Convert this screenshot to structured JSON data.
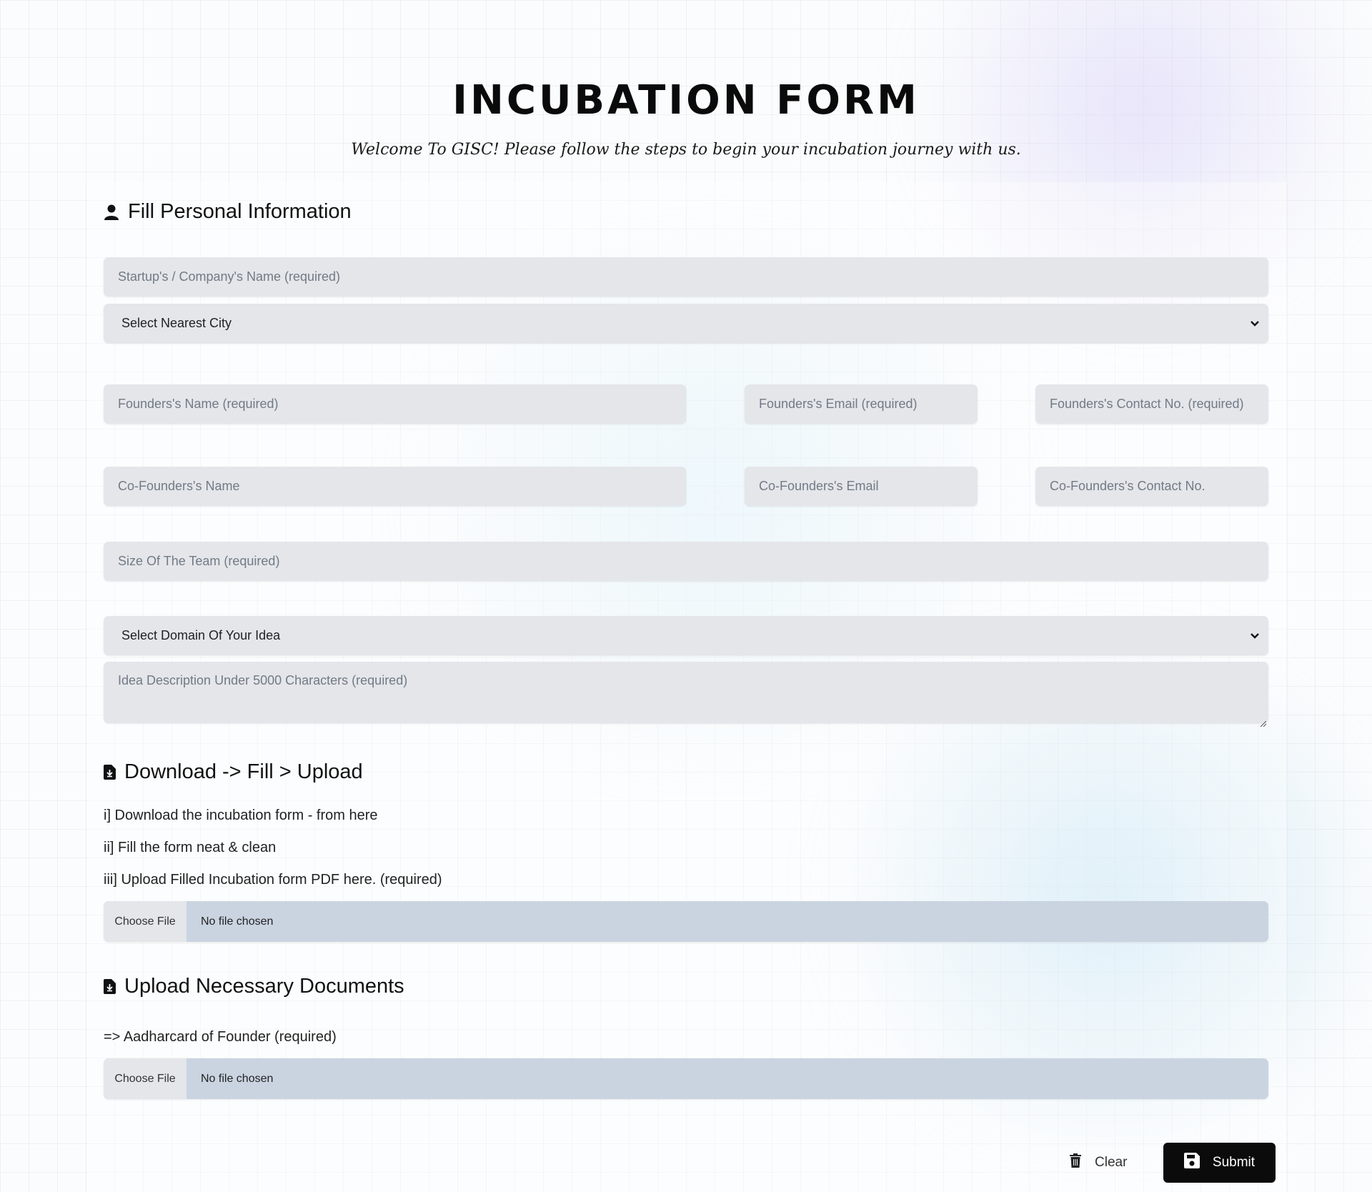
{
  "header": {
    "title": "INCUBATION FORM",
    "subtitle": "Welcome To GISC! Please follow the steps to begin your incubation journey with us."
  },
  "personal": {
    "heading": "Fill Personal Information",
    "heading_icon": "user-icon",
    "company_name_placeholder": "Startup's / Company's Name (required)",
    "city_select": "Select Nearest City",
    "founder_name_placeholder": "Founders's Name (required)",
    "founder_email_placeholder": "Founders's Email (required)",
    "founder_contact_placeholder": "Founders's Contact No. (required)",
    "cofounder_name_placeholder": "Co-Founders's Name",
    "cofounder_email_placeholder": "Co-Founders's Email",
    "cofounder_contact_placeholder": "Co-Founders's Contact No.",
    "team_size_placeholder": "Size Of The Team (required)",
    "domain_select": "Select Domain Of Your Idea",
    "idea_placeholder": "Idea Description Under 5000 Characters (required)"
  },
  "download_section": {
    "heading": "Download -> Fill > Upload",
    "heading_icon": "file-download-icon",
    "step1": "i] Download the incubation form - from here",
    "step2": "ii] Fill the form neat & clean",
    "step3": "iii] Upload Filled Incubation form PDF here. (required)",
    "file_button": "Choose File",
    "file_status": "No file chosen"
  },
  "documents_section": {
    "heading": "Upload Necessary Documents",
    "heading_icon": "file-upload-icon",
    "aadhar_label": "=> Aadharcard of Founder (required)",
    "file_button": "Choose File",
    "file_status": "No file chosen"
  },
  "actions": {
    "clear_label": "Clear",
    "clear_icon": "trash-icon",
    "submit_label": "Submit",
    "submit_icon": "save-icon"
  },
  "colors": {
    "field_bg": "#e4e6ea",
    "file_bg": "#cad4e1",
    "submit_bg": "#0b0b0b"
  }
}
